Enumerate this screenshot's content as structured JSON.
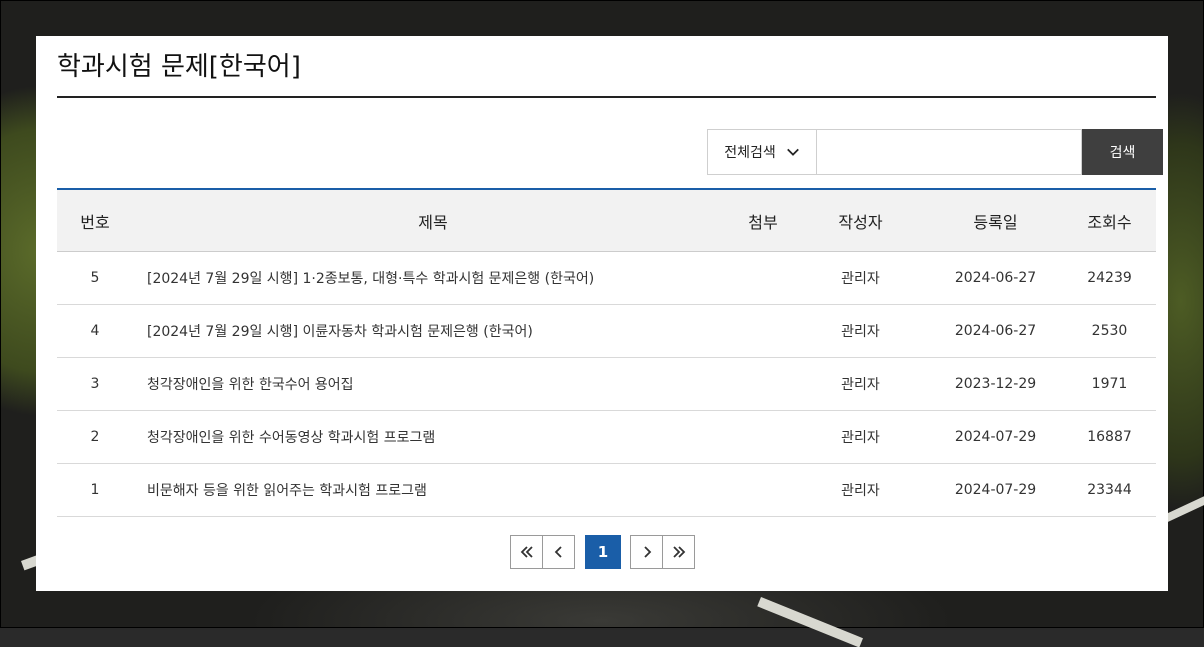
{
  "page": {
    "title": "학과시험 문제[한국어]"
  },
  "search": {
    "scope_label": "전체검색",
    "input_value": "",
    "input_placeholder": "",
    "button_label": "검색"
  },
  "table": {
    "columns": [
      "번호",
      "제목",
      "첨부",
      "작성자",
      "등록일",
      "조회수"
    ],
    "rows": [
      {
        "no": "5",
        "title": "[2024년 7월 29일 시행] 1·2종보통, 대형·특수 학과시험 문제은행 (한국어)",
        "attach": "",
        "author": "관리자",
        "date": "2024-06-27",
        "views": "24239"
      },
      {
        "no": "4",
        "title": "[2024년 7월 29일 시행] 이륜자동차 학과시험 문제은행 (한국어)",
        "attach": "",
        "author": "관리자",
        "date": "2024-06-27",
        "views": "2530"
      },
      {
        "no": "3",
        "title": "청각장애인을 위한 한국수어 용어집",
        "attach": "",
        "author": "관리자",
        "date": "2023-12-29",
        "views": "1971"
      },
      {
        "no": "2",
        "title": "청각장애인을 위한 수어동영상 학과시험 프로그램",
        "attach": "",
        "author": "관리자",
        "date": "2024-07-29",
        "views": "16887"
      },
      {
        "no": "1",
        "title": "비문해자 등을 위한 읽어주는 학과시험 프로그램",
        "attach": "",
        "author": "관리자",
        "date": "2024-07-29",
        "views": "23344"
      }
    ]
  },
  "pagination": {
    "current_page": "1",
    "icons": [
      "first-page-icon",
      "prev-page-icon",
      "next-page-icon",
      "last-page-icon"
    ]
  },
  "colors": {
    "accent": "#1a5ea8",
    "search_button": "#3f3f3f",
    "header_bg": "#f2f2f2"
  }
}
